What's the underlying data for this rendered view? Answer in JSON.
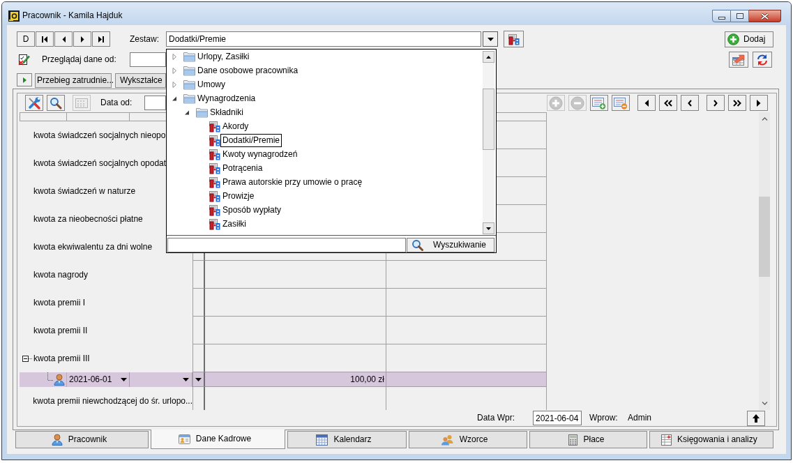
{
  "window": {
    "title": "Pracownik - Kamila Hajduk"
  },
  "record_toolbar": {
    "mode_button": "D"
  },
  "set_selector": {
    "label": "Zestaw:",
    "value": "Dodatki/Premie",
    "expanded": true,
    "dropdown": {
      "tree": [
        {
          "label": "Urlopy, Zasiłki",
          "kind": "folder",
          "expanded": false,
          "selected": false
        },
        {
          "label": "Dane osobowe pracownika",
          "kind": "folder",
          "expanded": false,
          "selected": false
        },
        {
          "label": "Umowy",
          "kind": "folder",
          "expanded": false,
          "selected": false
        },
        {
          "label": "Wynagrodzenia",
          "kind": "folder",
          "expanded": true,
          "selected": false,
          "children": [
            {
              "label": "Składniki",
              "kind": "folder",
              "expanded": true,
              "selected": false,
              "children": [
                {
                  "label": "Akordy",
                  "kind": "set",
                  "selected": false
                },
                {
                  "label": "Dodatki/Premie",
                  "kind": "set",
                  "selected": true
                },
                {
                  "label": "Kwoty wynagrodzeń",
                  "kind": "set",
                  "selected": false
                },
                {
                  "label": "Potrącenia",
                  "kind": "set",
                  "selected": false
                },
                {
                  "label": "Prawa autorskie przy umowie o pracę",
                  "kind": "set",
                  "selected": false
                },
                {
                  "label": "Prowizje",
                  "kind": "set",
                  "selected": false
                },
                {
                  "label": "Sposób wypłaty",
                  "kind": "set",
                  "selected": false
                },
                {
                  "label": "Zasiłki",
                  "kind": "set",
                  "selected": false
                }
              ]
            }
          ]
        }
      ],
      "search_button": "Wyszukiwanie"
    }
  },
  "browse_from": {
    "label": "Przeglądaj dane od:"
  },
  "add_button": {
    "label": "Dodaj"
  },
  "section_tabs": [
    {
      "label": "Przebieg zatrudnie...",
      "selected": false
    },
    {
      "label": "Wykształce",
      "selected": false
    }
  ],
  "grid_toolbar": {
    "left_buttons": [
      {
        "kind": "tools",
        "disabled": false
      },
      {
        "kind": "search",
        "disabled": false
      },
      {
        "kind": "keypad",
        "disabled": true
      }
    ],
    "date_label": "Data od:",
    "row_buttons": [
      {
        "kind": "add",
        "disabled": true
      },
      {
        "kind": "remove",
        "disabled": true
      },
      {
        "kind": "add_row",
        "disabled": false
      },
      {
        "kind": "remove_row",
        "disabled": false
      }
    ]
  },
  "grid": {
    "rows": [
      {
        "label": "kwota świadczeń socjalnych nieopo",
        "kind": "plain"
      },
      {
        "label": "kwota świadczeń socjalnych opodat",
        "kind": "plain"
      },
      {
        "label": "kwota świadczeń w naturze",
        "kind": "plain"
      },
      {
        "label": "kwota za nieobecności płatne",
        "kind": "plain"
      },
      {
        "label": "kwota ekwiwalentu za dni wolne",
        "kind": "plain"
      },
      {
        "label": "kwota nagrody",
        "kind": "plain"
      },
      {
        "label": "kwota premii I",
        "kind": "plain"
      },
      {
        "label": "kwota premii II",
        "kind": "plain"
      },
      {
        "label": "kwota premii III",
        "kind": "group",
        "expanded": true,
        "children": [
          {
            "date": "2021-06-01",
            "amount": "100,00 zł",
            "selected": true
          }
        ]
      },
      {
        "label": "kwota premii niewchodzącej do śr. urlopo...",
        "kind": "plain"
      }
    ]
  },
  "footer": {
    "entry_date_label": "Data Wpr:",
    "entry_date": "2021-06-04",
    "entered_by_label": "Wprow:",
    "entered_by": "Admin"
  },
  "bottom_tabs": [
    {
      "label": "Pracownik",
      "kind": "employee",
      "selected": false
    },
    {
      "label": "Dane Kadrowe",
      "kind": "hr_data",
      "selected": true
    },
    {
      "label": "Kalendarz",
      "kind": "calendar",
      "selected": false
    },
    {
      "label": "Wzorce",
      "kind": "templates",
      "selected": false
    },
    {
      "label": "Płace",
      "kind": "payroll",
      "selected": false
    },
    {
      "label": "Księgowania i analizy",
      "kind": "accounting",
      "selected": false
    }
  ]
}
